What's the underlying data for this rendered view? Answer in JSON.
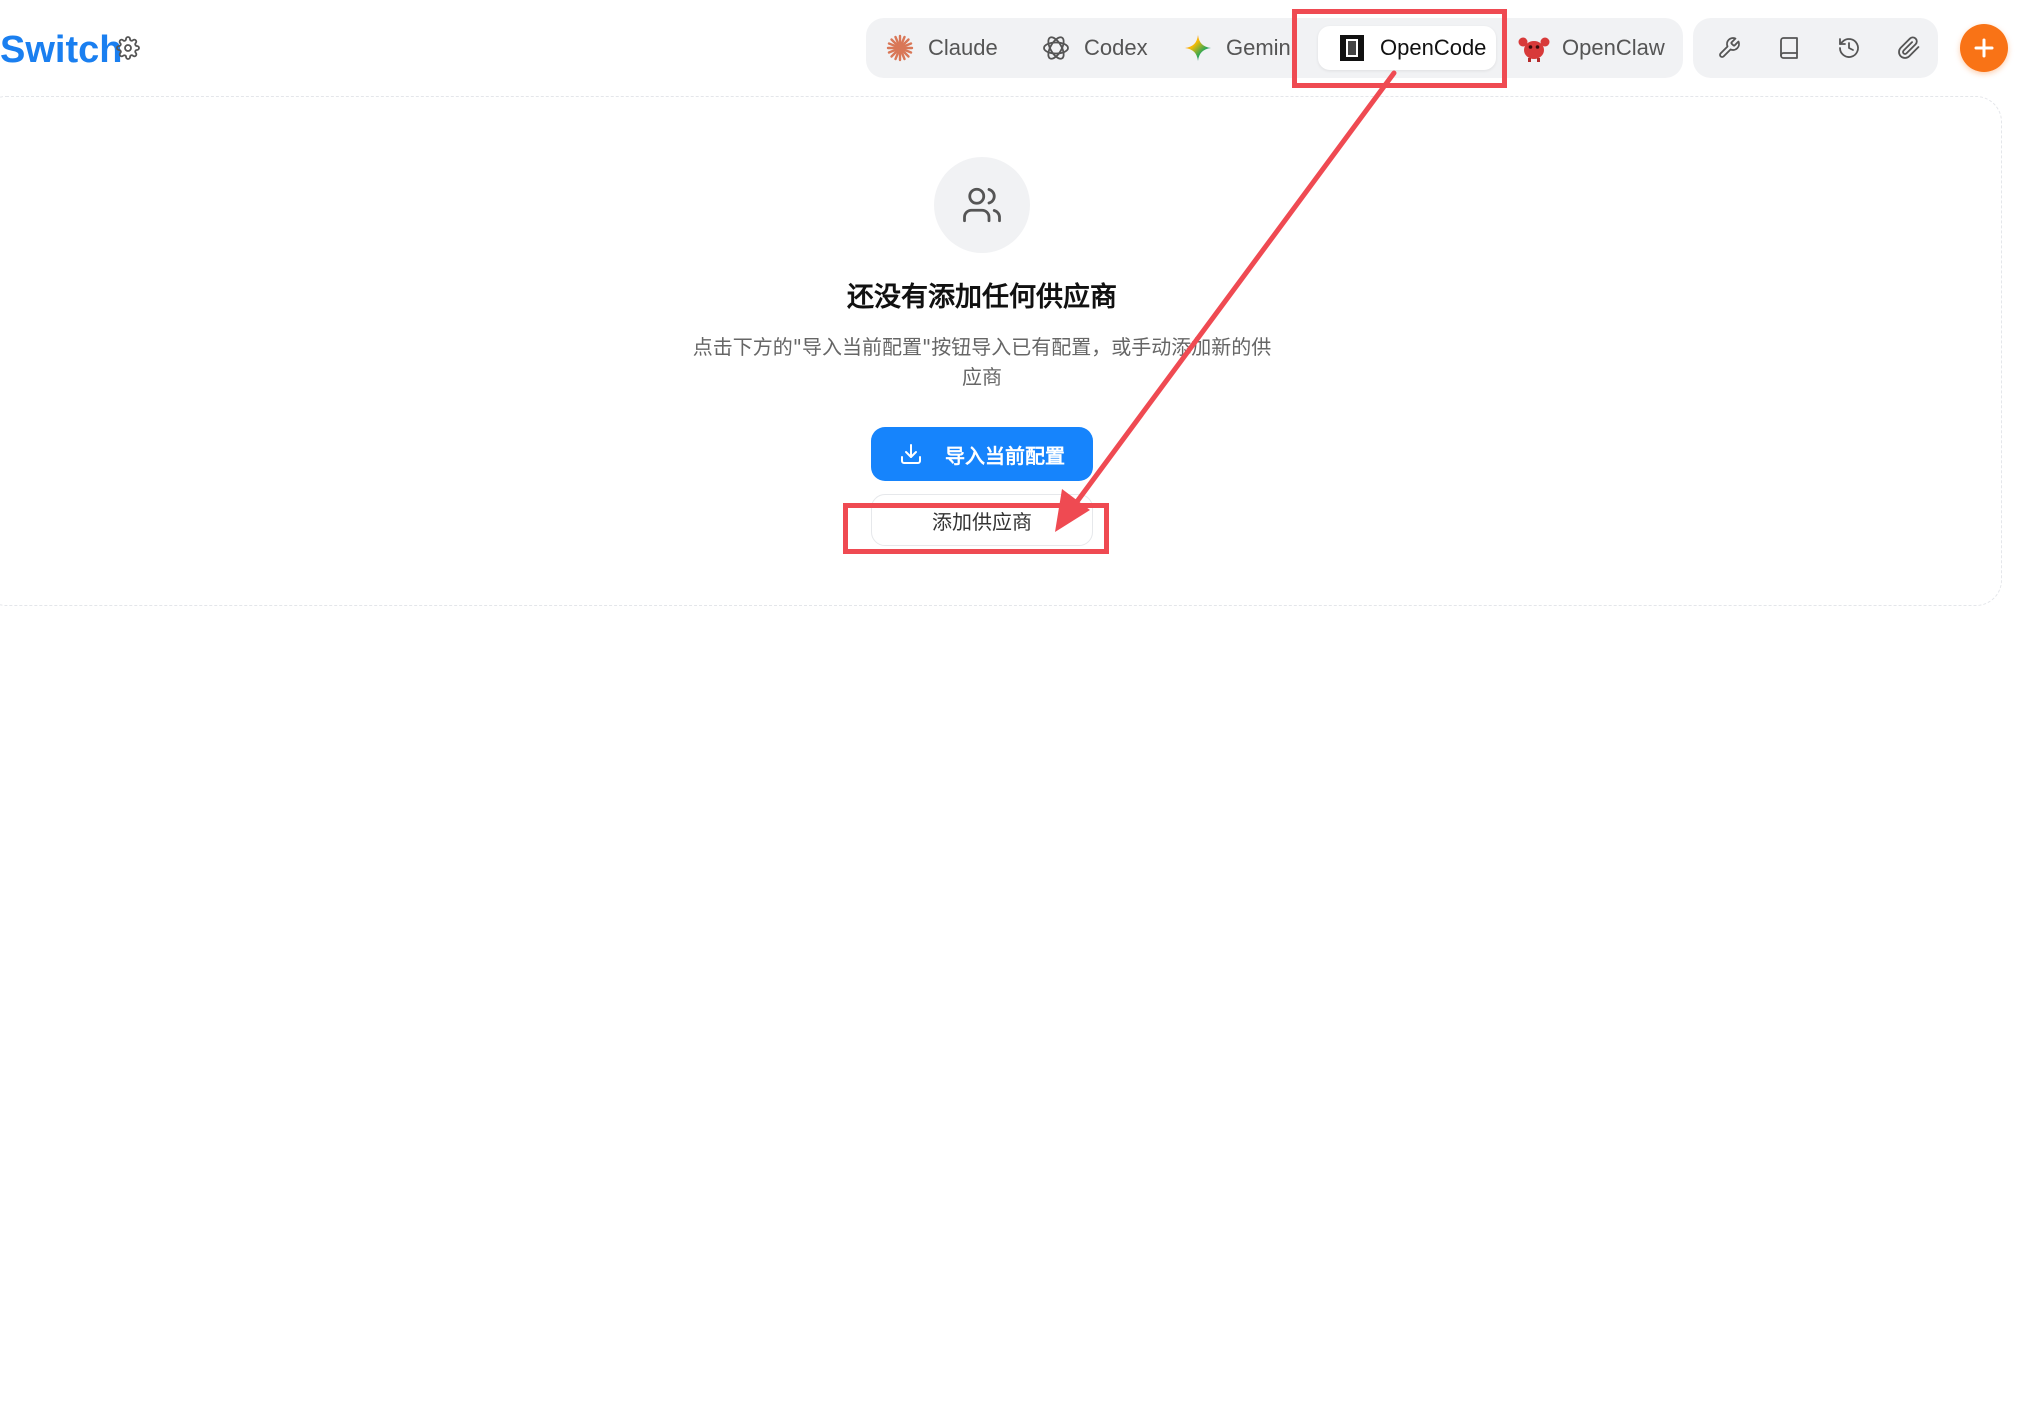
{
  "header": {
    "brand": "Switch",
    "settings_icon": "gear-icon"
  },
  "tabs": [
    {
      "label": "Claude",
      "icon": "claude-starburst-icon",
      "color": "#d97757"
    },
    {
      "label": "Codex",
      "icon": "openai-knot-icon",
      "color": "#555555"
    },
    {
      "label": "Gemini",
      "icon": "gemini-sparkle-icon",
      "color": "#4285f4"
    },
    {
      "label": "OpenCode",
      "icon": "opencode-square-icon",
      "color": "#111111",
      "active": true
    },
    {
      "label": "OpenClaw",
      "icon": "openclaw-crab-icon",
      "color": "#d83a3a"
    }
  ],
  "toolbar": {
    "items": [
      "wrench-icon",
      "book-icon",
      "history-icon",
      "paperclip-icon"
    ],
    "add_icon": "plus-icon",
    "add_color": "#f97316"
  },
  "empty_state": {
    "icon": "users-icon",
    "title": "还没有添加任何供应商",
    "description": "点击下方的\"导入当前配置\"按钮导入已有配置，或手动添加新的供应商",
    "import_label": "导入当前配置",
    "add_label": "添加供应商"
  },
  "annotation": {
    "color": "#ef4a52"
  }
}
